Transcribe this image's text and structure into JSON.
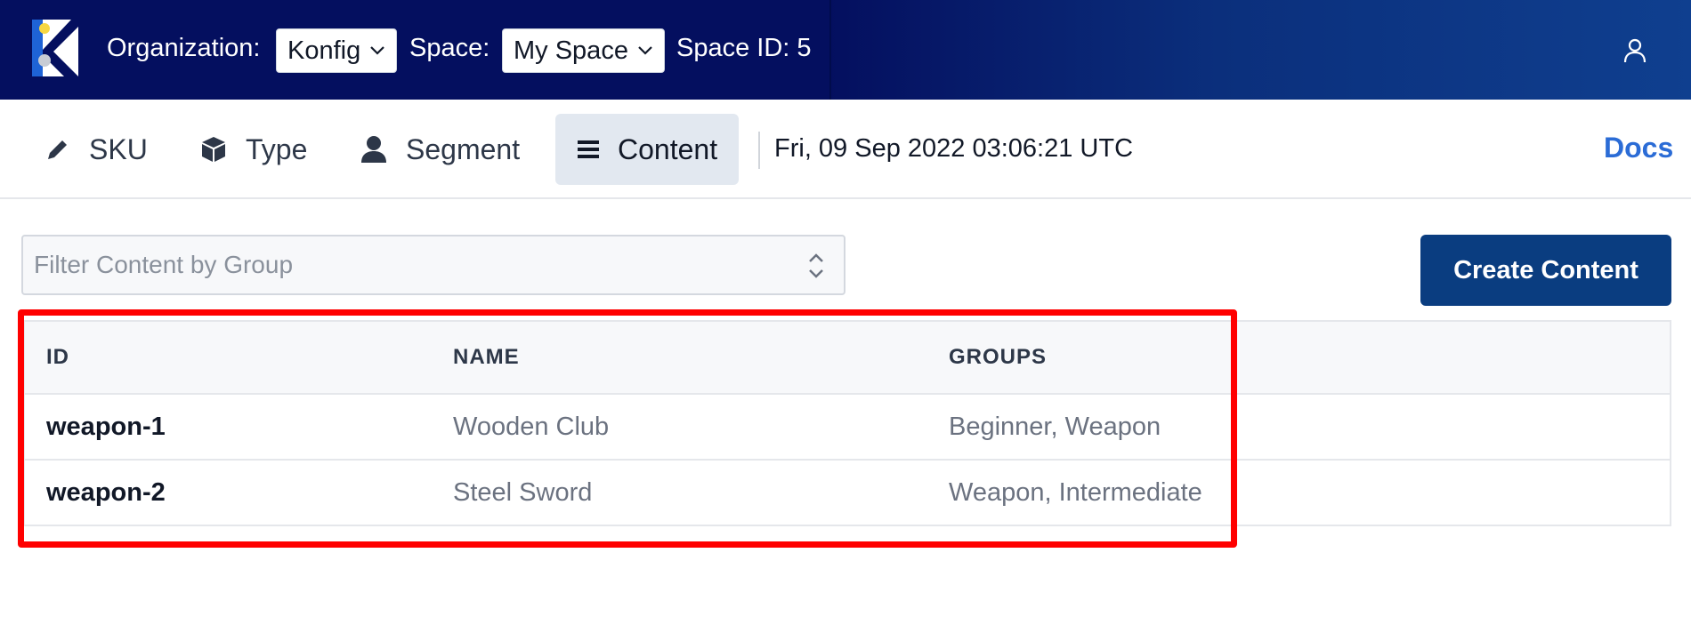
{
  "header": {
    "org_label": "Organization:",
    "org_value": "Konfig",
    "space_label": "Space:",
    "space_value": "My Space",
    "space_id": "Space ID: 5",
    "colors": {
      "bar_left": "#040f5f",
      "bar_right": "#0f3f8f"
    }
  },
  "nav": {
    "tabs": [
      {
        "label": "SKU",
        "icon": "pencil-icon"
      },
      {
        "label": "Type",
        "icon": "cube-icon"
      },
      {
        "label": "Segment",
        "icon": "user-icon"
      },
      {
        "label": "Content",
        "icon": "list-icon",
        "active": true
      }
    ],
    "datetime": "Fri, 09 Sep 2022 03:06:21 UTC",
    "docs_label": "Docs"
  },
  "filter": {
    "placeholder": "Filter Content by Group"
  },
  "create_button": {
    "label": "Create Content",
    "color": "#0a3d80"
  },
  "table": {
    "headers": [
      "ID",
      "NAME",
      "GROUPS"
    ],
    "rows": [
      {
        "id": "weapon-1",
        "name": "Wooden Club",
        "groups": "Beginner, Weapon"
      },
      {
        "id": "weapon-2",
        "name": "Steel Sword",
        "groups": "Weapon, Intermediate"
      }
    ]
  },
  "highlight_color": "#ff0000"
}
